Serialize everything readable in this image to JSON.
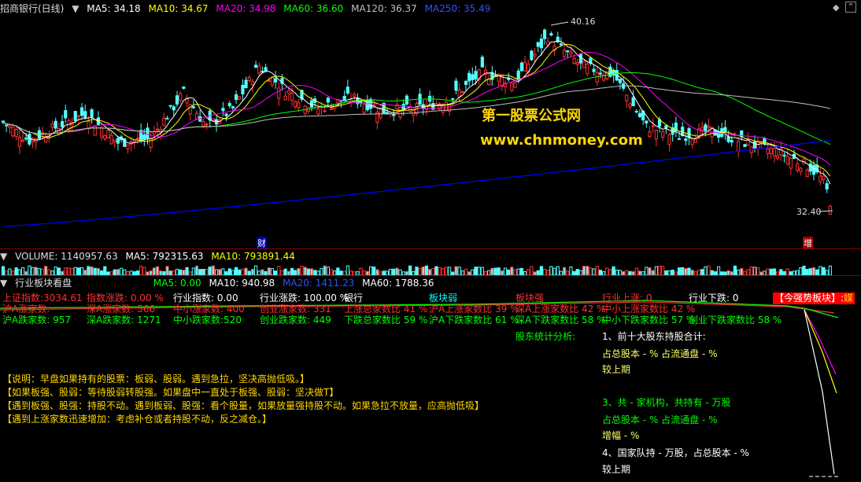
{
  "main": {
    "title": "招商银行(日线)",
    "ma5": "MA5: 34.18",
    "ma10": "MA10: 34.67",
    "ma20": "MA20: 34.98",
    "ma60": "MA60: 36.60",
    "ma120": "MA120: 36.37",
    "ma250": "MA250: 35.49",
    "high_label": "40.16",
    "low_label": "32.40",
    "marker_cai": "财",
    "marker_zeng": "增",
    "watermark_name": "第一股票公式网",
    "watermark_url": "www.chnmoney.com"
  },
  "volume": {
    "title": "VOLUME: 1140957.63",
    "ma5": "MA5: 792315.63",
    "ma10": "MA10: 793891.44"
  },
  "indicator": {
    "title": "行业板块看盘",
    "ma5": "MA5: 0.00",
    "ma10": "MA10: 940.98",
    "ma20": "MA20: 1411.23",
    "ma60": "MA60: 1788.36",
    "badge": "【今强势板块】:",
    "badge_tail": "媒",
    "row1": [
      {
        "text": "上证指数:3034.61",
        "color": "#ff3030"
      },
      {
        "text": "指数涨跌: 0.00 %",
        "color": "#ff3030"
      },
      {
        "text": "行业指数: 0.00",
        "color": "#ffffff"
      },
      {
        "text": "行业涨跌: 100.00 %",
        "color": "#ffffff"
      },
      {
        "text": "银行",
        "color": "#ffffff"
      },
      {
        "text": "板块弱",
        "color": "#00ffff"
      },
      {
        "text": "板块强",
        "color": "#ff3030"
      },
      {
        "text": "行业上涨: 0",
        "color": "#ff3030"
      },
      {
        "text": "行业下跌: 0",
        "color": "#ffffff"
      }
    ],
    "row2": [
      {
        "text": "沪A涨家数:",
        "color": "#ff3030"
      },
      {
        "text": "深A涨家数: 566",
        "color": "#ff3030"
      },
      {
        "text": "中小涨家数: 400",
        "color": "#ff3030"
      },
      {
        "text": "创业涨家数: 331",
        "color": "#ff3030"
      },
      {
        "text": "上涨总家数比 41 %",
        "color": "#ff3030"
      },
      {
        "text": "沪A上涨家数比 39 %",
        "color": "#ff3030"
      },
      {
        "text": "深A上涨家数比 42 %",
        "color": "#ff3030"
      },
      {
        "text": "中小上涨家数比 42 %",
        "color": "#ff3030"
      }
    ],
    "row3": [
      {
        "text": "沪A跌家数: 957",
        "color": "#00ff00"
      },
      {
        "text": "深A跌家数: 1271",
        "color": "#00ff00"
      },
      {
        "text": "中小跌家数:520",
        "color": "#00ff00"
      },
      {
        "text": "创业跌家数: 449",
        "color": "#00ff00"
      },
      {
        "text": "下跌总家数比 59 %",
        "color": "#00ff00"
      },
      {
        "text": "沪A下跌家数比 61 %",
        "color": "#00ff00"
      },
      {
        "text": "深A下跌家数比 58 %",
        "color": "#00ff00"
      },
      {
        "text": "中小下跌家数比 57 %",
        "color": "#00ff00"
      },
      {
        "text": "创业下跌家数比 58 %",
        "color": "#00ff00"
      }
    ],
    "holder_title": "股东统计分析:",
    "holder_lines": [
      {
        "text": "1、前十大股东持股合计:",
        "color": "#ffffff"
      },
      {
        "text": "占总股本 - %   占流通盘 - %",
        "color": "#ffff66"
      },
      {
        "text": "较上期",
        "color": "#ffff66"
      },
      {
        "text": "3、共 - 家机构，共持有 - 万股",
        "color": "#00ff00"
      },
      {
        "text": "占总股本 - %   占流通盘 - %",
        "color": "#00ff00"
      },
      {
        "text": "增幅 - %",
        "color": "#ffff66"
      },
      {
        "text": "4、国家队持 - 万股，占总股本 - %",
        "color": "#ffffff"
      },
      {
        "text": "较上期",
        "color": "#ffffff"
      }
    ],
    "notes": [
      "【说明：早盘如果持有的股票：板弱、股弱。遇到急拉，坚决高抛低吸。】",
      "【如果板强、股弱：等待股弱转股强。如果盘中一直处于板强、股弱：坚决做T】",
      "【遇到板强、股强：持股不动。遇到板弱、股强：看个股量，如果放量强持股不动。如果急拉不放量，应高抛低吸】",
      "【遇到上涨家数迅速增加：考虑补仓或者持股不动，反之减仓。】"
    ]
  },
  "colors": {
    "up": "#ff3030",
    "down": "#54ffff",
    "ma5": "#ffffff",
    "ma10": "#ffff00",
    "ma20": "#ff00ff",
    "ma60": "#00ff00",
    "ma120": "#c0c0c0",
    "ma250": "#0000ff"
  }
}
